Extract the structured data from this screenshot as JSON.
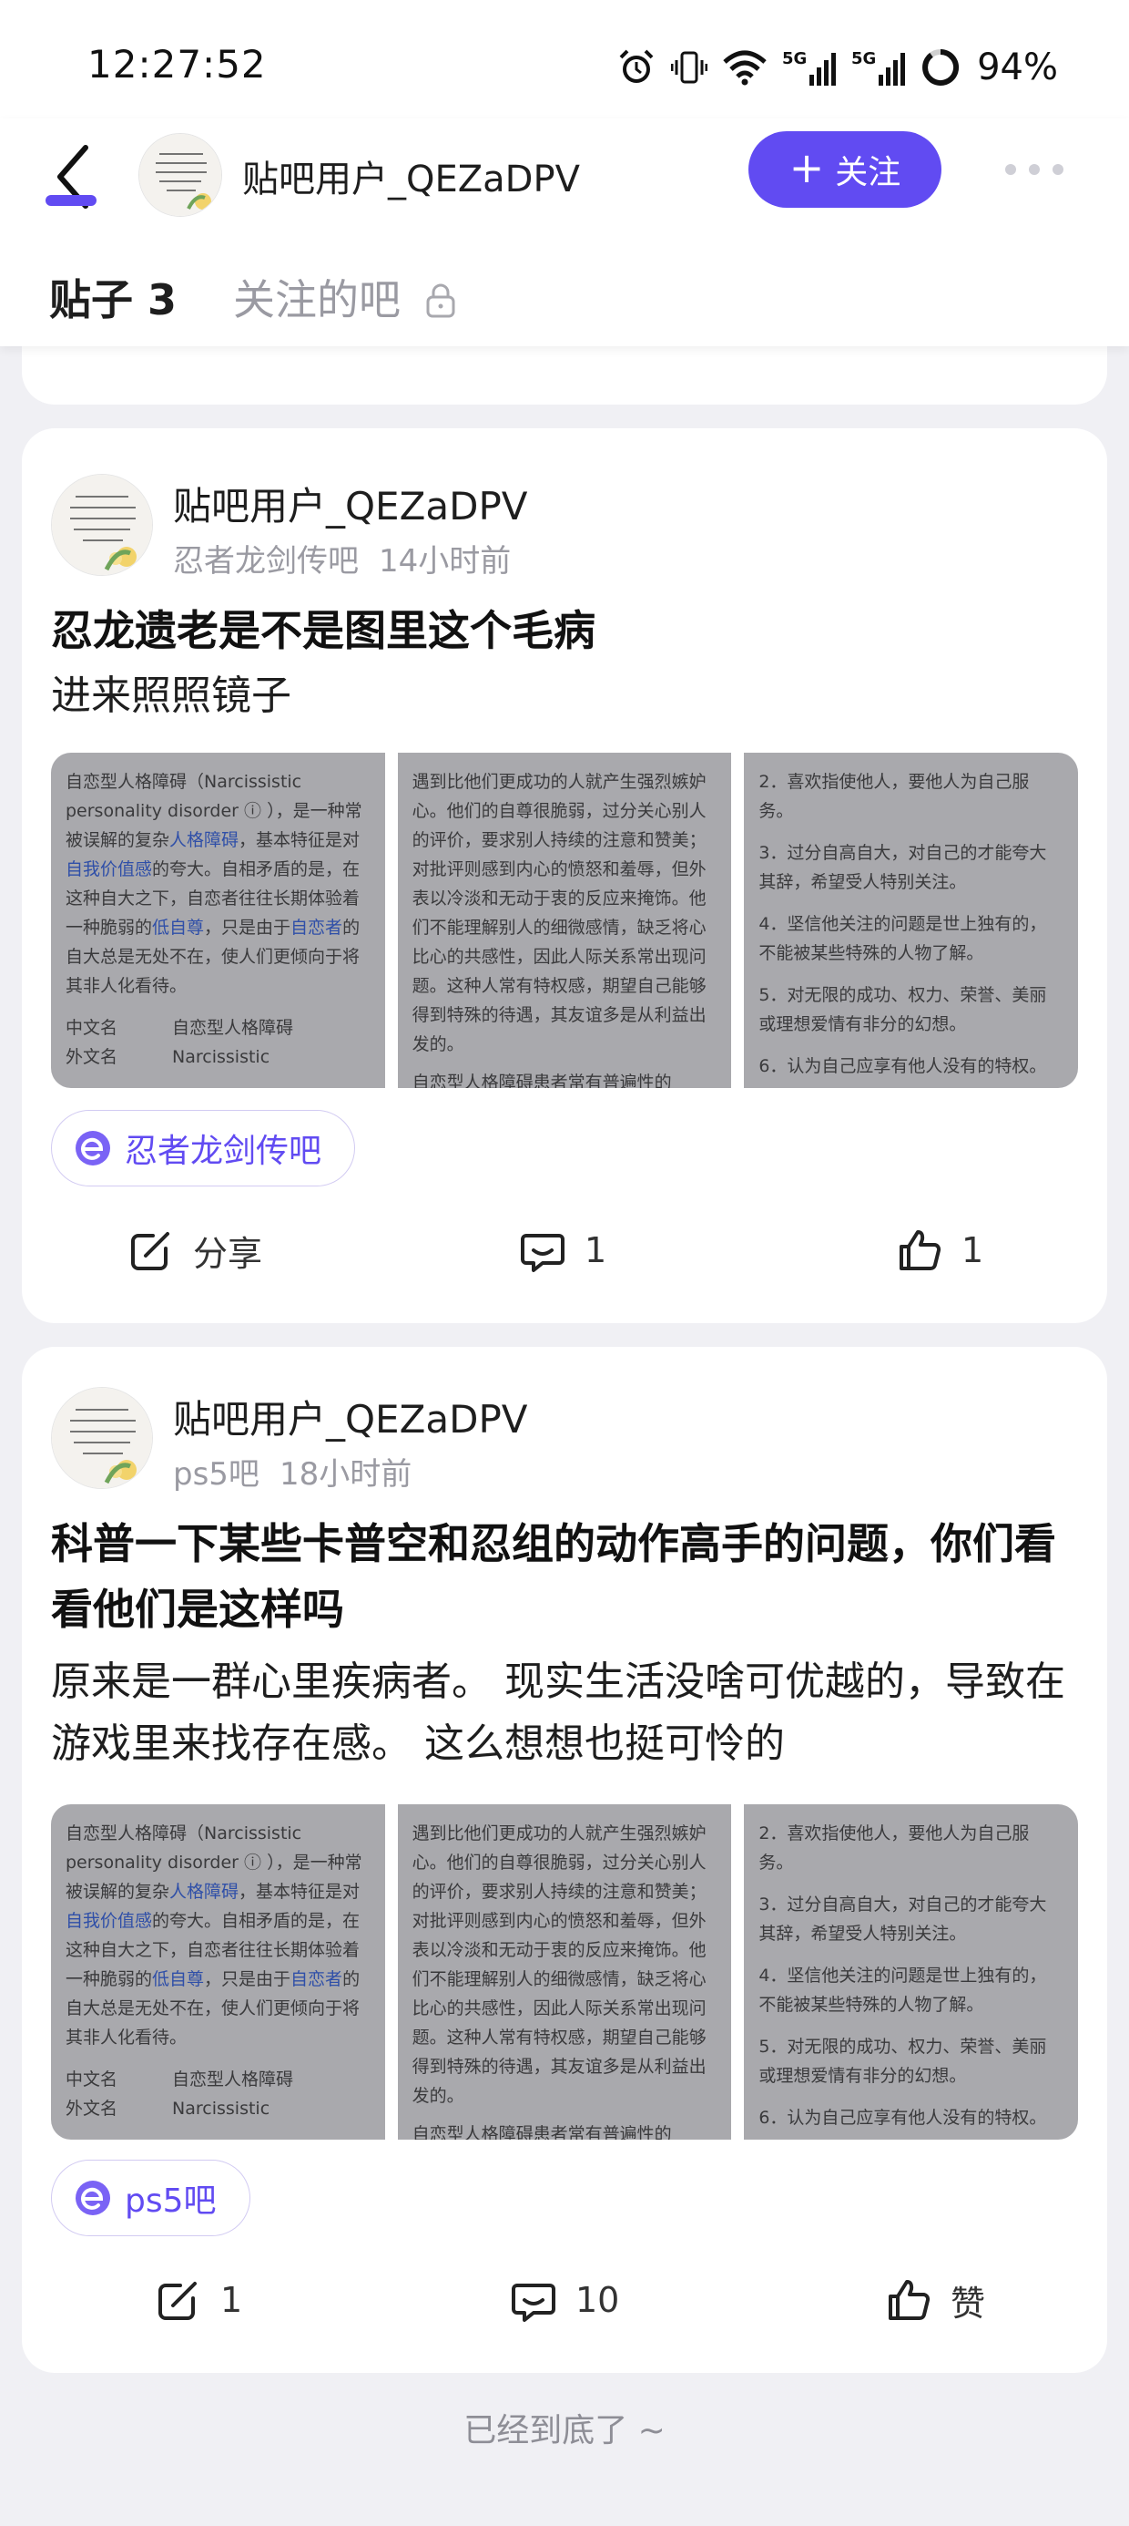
{
  "status_bar": {
    "time": "12:27:52",
    "network_1": "5G",
    "network_2": "5G",
    "battery": "94%",
    "icons": [
      "alarm-icon",
      "vibrate-icon",
      "wifi-icon",
      "signal-5g-icon",
      "signal-5g-icon",
      "battery-icon"
    ]
  },
  "header": {
    "back_icon": "chevron-left-icon",
    "user_name": "贴吧用户_QEZaDPV",
    "follow_label": "关注",
    "more_icon": "more-horizontal-icon",
    "tabs": [
      {
        "label": "贴子 3",
        "active": true
      },
      {
        "label": "关注的吧",
        "active": false,
        "locked": true
      }
    ]
  },
  "colors": {
    "accent": "#614bf2",
    "background": "#f0f0f4",
    "card": "#ffffff",
    "muted_text": "#9a9aa2"
  },
  "posts": [
    {
      "author": "贴吧用户_QEZaDPV",
      "forum": "忍者龙剑传吧",
      "time": "14小时前",
      "title": "忍龙遗老是不是图里这个毛病",
      "body": "进来照照镜子",
      "forum_tag": "忍者龙剑传吧",
      "share_label": "分享",
      "comments": "1",
      "likes": "1"
    },
    {
      "author": "贴吧用户_QEZaDPV",
      "forum": "ps5吧",
      "time": "18小时前",
      "title": "科普一下某些卡普空和忍组的动作高手的问题，你们看看他们是这样吗",
      "body": "原来是一群心里疾病者。 现实生活没啥可优越的，导致在游戏里来找存在感。 这么想想也挺可怜的",
      "forum_tag": "ps5吧",
      "share_count": "1",
      "comments": "10",
      "likes": "赞"
    }
  ],
  "thumb_text": {
    "t1_p1a": "自恋型人格障碍（Narcissistic personality disorder",
    "t1_p1b": "），是一种常被误解的复杂",
    "t1_link1": "人格障碍",
    "t1_p1c": "，基本特征是对",
    "t1_link2": "自我价值感",
    "t1_p1d": "的夸大。自相矛盾的是，在这种自大之下，自恋者往往长期体验着一种脆弱的",
    "t1_link3": "低自尊",
    "t1_p1e": "，只是由于",
    "t1_link4": "自恋者",
    "t1_p1f": "的自大总是无处不在，使人们更倾向于将其非人化看待。",
    "t1_row1_k": "中文名",
    "t1_row1_v": "自恋型人格障碍",
    "t1_row2_k": "外文名",
    "t1_row2_v": "Narcissistic",
    "t2_p1": "遇到比他们更成功的人就产生强烈嫉妒心。他们的自尊很脆弱，过分关心别人的评价，要求别人持续的注意和赞美；对批评则感到内心的愤怒和羞辱，但外表以冷淡和无动于衷的反应来掩饰。他们不能理解别人的细微感情，缺乏将心比心的共感性，因此人际关系常出现问题。这种人常有特权感，期望自己能够得到特殊的待遇，其友谊多是从利益出发的。",
    "t2_p2": "自恋型人格障碍患者常有普遍性的",
    "t3_items": [
      "2．喜欢指使他人，要他人为自己服务。",
      "3．过分自高自大，对自己的才能夸大其辞，希望受人特别关注。",
      "4．坚信他关注的问题是世上独有的，不能被某些特殊的人物了解。",
      "5．对无限的成功、权力、荣誉、美丽或理想爱情有非分的幻想。",
      "6．认为自己应享有他人没有的特权。"
    ]
  },
  "footer": {
    "end_text": "已经到底了 ~"
  }
}
